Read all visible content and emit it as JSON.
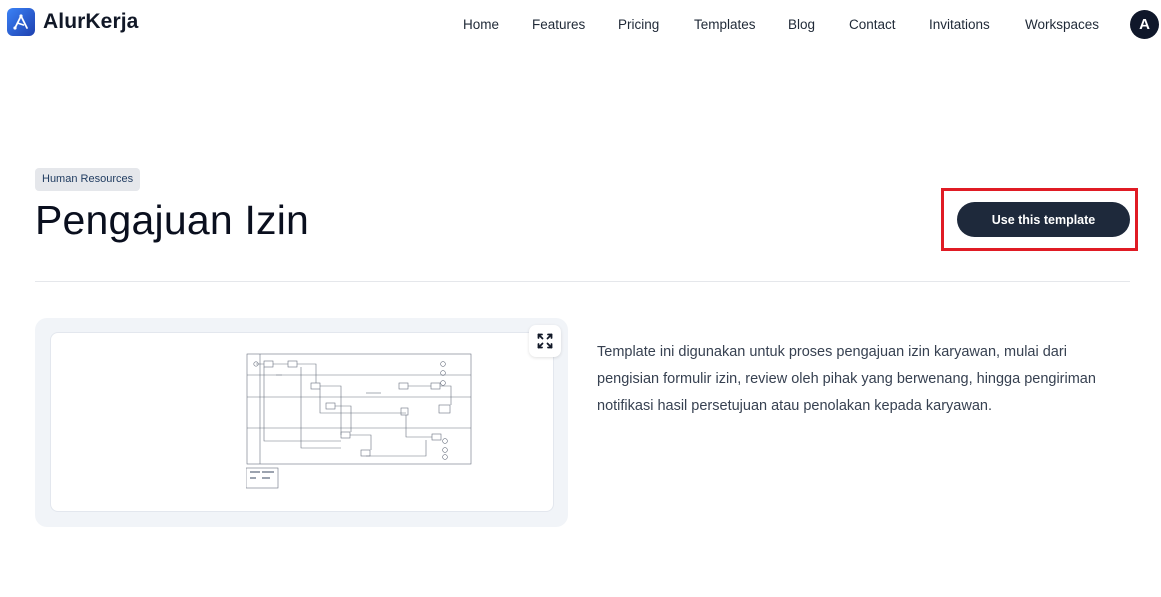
{
  "brand": {
    "name": "AlurKerja",
    "logo_icon": "workflow-logo-icon",
    "accent": "#1d4ed8"
  },
  "nav": {
    "items": [
      {
        "label": "Home"
      },
      {
        "label": "Features"
      },
      {
        "label": "Pricing"
      },
      {
        "label": "Templates"
      },
      {
        "label": "Blog"
      },
      {
        "label": "Contact"
      },
      {
        "label": "Invitations"
      },
      {
        "label": "Workspaces"
      }
    ],
    "avatar_initial": "A"
  },
  "template": {
    "category": "Human Resources",
    "title": "Pengajuan Izin",
    "use_button_label": "Use this template",
    "description": "Template ini digunakan untuk proses pengajuan izin karyawan, mulai dari pengisian formulir izin, review oleh pihak yang berwenang, hingga pengiriman notifikasi hasil persetujuan atau penolakan kepada karyawan.",
    "preview_icon": "bpmn-diagram-thumbnail",
    "expand_icon": "expand-icon"
  },
  "colors": {
    "primary_button": "#1e293b",
    "highlight": "#e01b24",
    "badge_bg": "#e5e7eb"
  }
}
